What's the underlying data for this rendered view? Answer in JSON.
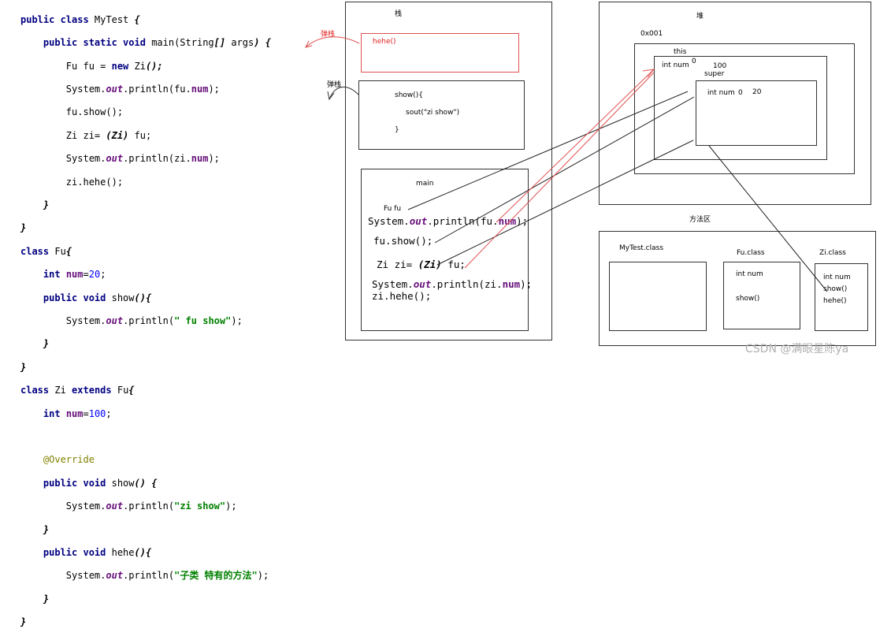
{
  "code": {
    "l1_kw": "public class ",
    "l1_name": "MyTest ",
    "l1_brace": "{",
    "l2_kw": "public static void ",
    "l2_name": "main(String",
    "l2_arr": "[]",
    "l2_args": " args",
    "l2_close": ") {",
    "l3_a": "Fu fu = ",
    "l3_new": "new ",
    "l3_b": "Zi",
    "l3_c": "();",
    "l4_a": "System.",
    "l4_out": "out",
    "l4_b": ".println(fu.",
    "l4_num": "num",
    "l4_c": ");",
    "l5": "fu.show();",
    "l6_a": "Zi zi= ",
    "l6_b": "(Zi)",
    "l6_c": " fu;",
    "l7_a": "System.",
    "l7_out": "out",
    "l7_b": ".println(zi.",
    "l7_num": "num",
    "l7_c": ");",
    "l8": "zi.hehe();",
    "l9": "}",
    "l10": "}",
    "l11_kw": "class ",
    "l11_name": "Fu",
    "l11_brace": "{",
    "l12_kw": "int ",
    "l12_num": "num",
    "l12_eq": "=",
    "l12_val": "20",
    "l12_end": ";",
    "l13_kw": "public void ",
    "l13_name": "show",
    "l13_p": "(){",
    "l14_a": "System.",
    "l14_out": "out",
    "l14_b": ".println(",
    "l14_s": "\" fu show\"",
    "l14_c": ");",
    "l15": "}",
    "l16": "}",
    "l17_kw": "class ",
    "l17_name": "Zi ",
    "l17_ext": "extends ",
    "l17_sup": "Fu",
    "l17_brace": "{",
    "l18_kw": "int ",
    "l18_num": "num",
    "l18_eq": "=",
    "l18_val": "100",
    "l18_end": ";",
    "l20": "@Override",
    "l21_kw": "public void ",
    "l21_name": "show",
    "l21_p": "() {",
    "l22_a": "System.",
    "l22_out": "out",
    "l22_b": ".println(",
    "l22_s": "\"zi show\"",
    "l22_c": ");",
    "l23": "}",
    "l24_kw": "public void ",
    "l24_name": "hehe",
    "l24_p": "(){",
    "l25_a": "System.",
    "l25_out": "out",
    "l25_b": ".println(",
    "l25_s": "\"子类 特有的方法\"",
    "l25_c": ");",
    "l26": "}",
    "l27": "}"
  },
  "stack": {
    "title": "栈",
    "pop_label_1": "弹栈",
    "pop_label_2": "弹栈",
    "hehe_frame": "hehe()",
    "show_frame_line1": "show(){",
    "show_frame_line2": "sout(\"zi show\")",
    "show_frame_line3": "}",
    "main_title": "main",
    "main_fu": "Fu fu",
    "main_l1_a": "System.",
    "main_l1_out": "out",
    "main_l1_b": ".println(fu.",
    "main_l1_num": "num",
    "main_l1_c": ");",
    "main_l2": "fu.show();",
    "main_l3_a": "Zi zi= ",
    "main_l3_b": "(Zi)",
    "main_l3_c": " fu;",
    "main_l4_a": "System.",
    "main_l4_out": "out",
    "main_l4_b": ".println(zi.",
    "main_l4_num": "num",
    "main_l4_c": ");",
    "main_l5": "zi.hehe();"
  },
  "heap": {
    "title": "堆",
    "address": "0x001",
    "this_label": "this",
    "this_field": "int num",
    "this_value": "100",
    "super_label": "super",
    "super_field": "int num",
    "super_value": "20",
    "zero_1": "0",
    "zero_2": "0"
  },
  "method_area": {
    "title": "方法区",
    "mytest": "MyTest.class",
    "fu": "Fu.class",
    "fu_field": "int num",
    "fu_method": "show()",
    "zi": "Zi.class",
    "zi_field": "int num",
    "zi_m1": "show()",
    "zi_m2": "hehe()"
  },
  "watermark": "CSDN @满眼星陈ya",
  "colors": {
    "keyword": "#000080",
    "field": "#660e7a",
    "number": "#0000ff",
    "string": "#008000",
    "annotation": "#808000",
    "pointer_red": "#e05050"
  }
}
